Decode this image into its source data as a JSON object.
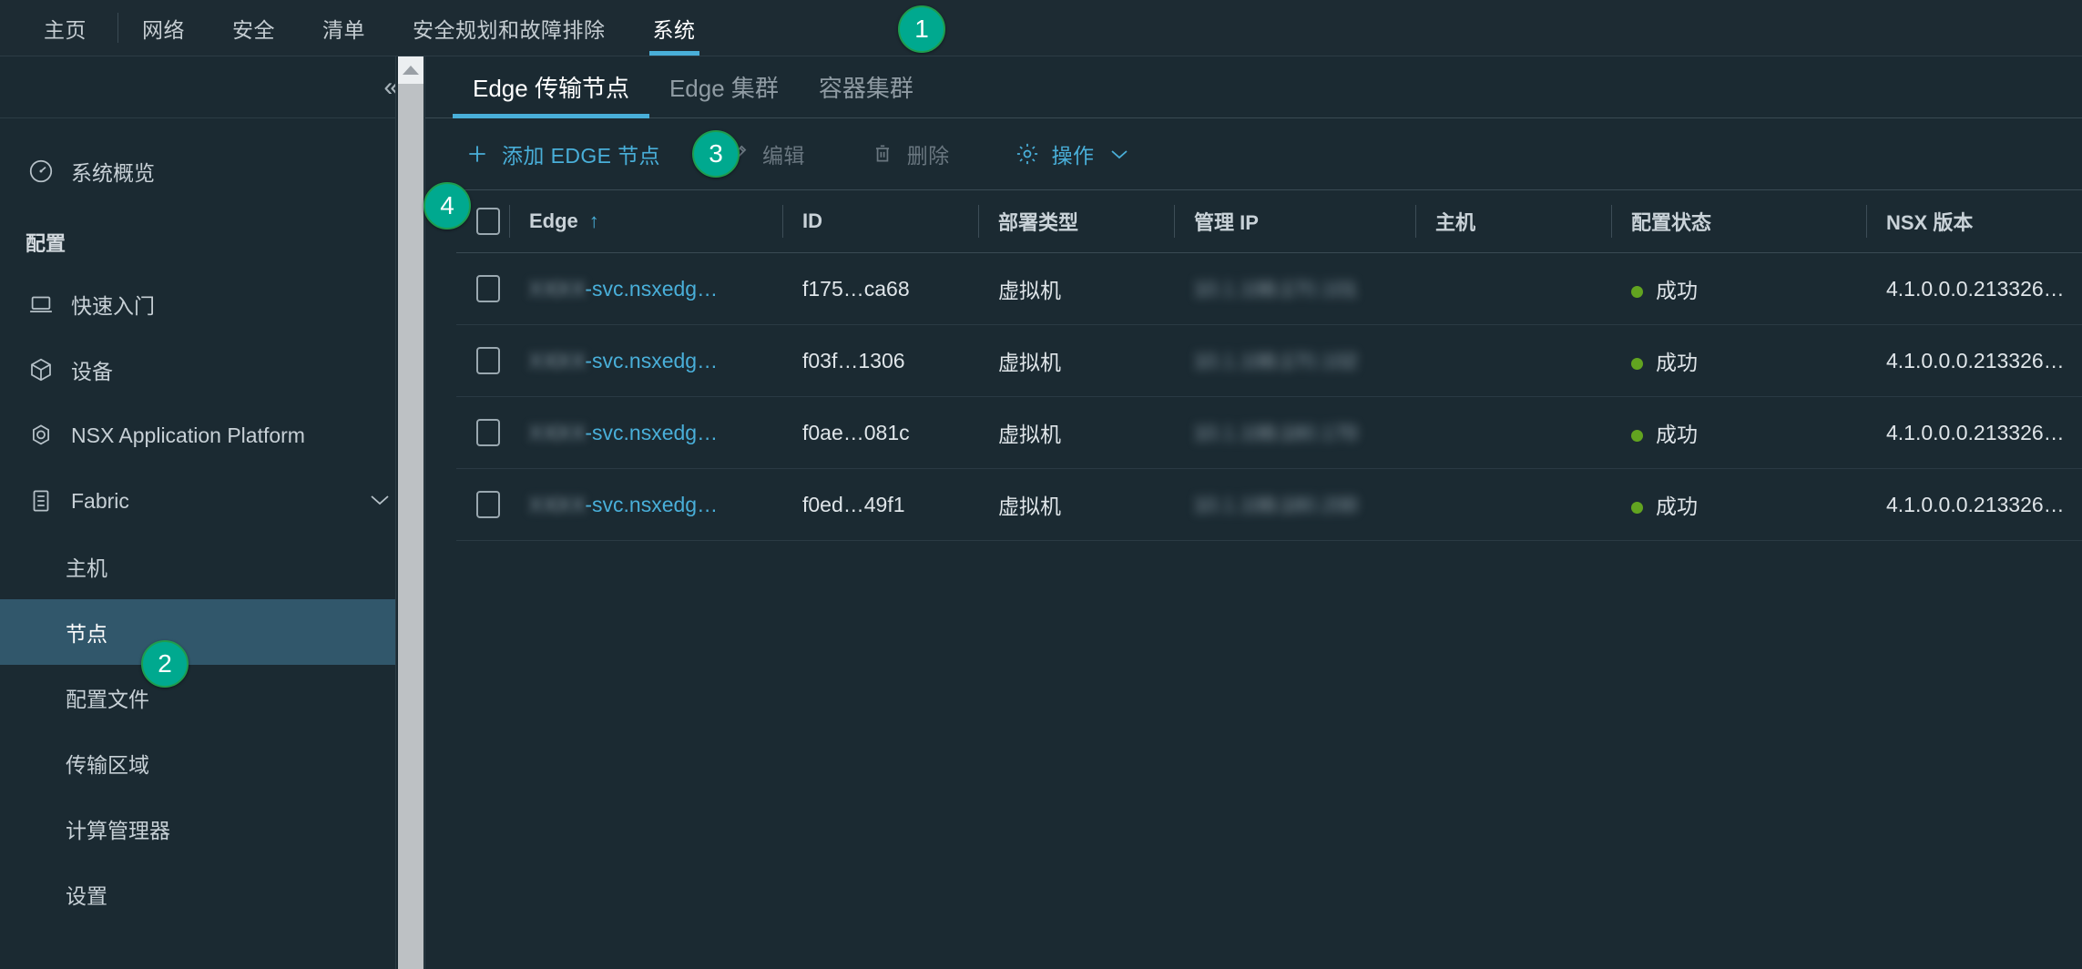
{
  "topnav": {
    "items": [
      {
        "label": "主页",
        "active": false
      },
      {
        "label": "网络",
        "active": false
      },
      {
        "label": "安全",
        "active": false
      },
      {
        "label": "清单",
        "active": false
      },
      {
        "label": "安全规划和故障排除",
        "active": false
      },
      {
        "label": "系统",
        "active": true
      }
    ]
  },
  "sidebar": {
    "collapse_icon": "double-chevron-left-icon",
    "overview": {
      "label": "系统概览",
      "icon": "dashboard-icon"
    },
    "group_title": "配置",
    "items": [
      {
        "label": "快速入门",
        "icon": "laptop-icon"
      },
      {
        "label": "设备",
        "icon": "cube-icon"
      },
      {
        "label": "NSX Application Platform",
        "icon": "nodes-icon"
      },
      {
        "label": "Fabric",
        "icon": "list-icon",
        "expandable": true,
        "caret": "chevron-down-icon"
      }
    ],
    "sub_items": [
      {
        "label": "主机",
        "selected": false
      },
      {
        "label": "节点",
        "selected": true
      },
      {
        "label": "配置文件",
        "selected": false
      },
      {
        "label": "传输区域",
        "selected": false
      },
      {
        "label": "计算管理器",
        "selected": false
      },
      {
        "label": "设置",
        "selected": false
      }
    ]
  },
  "tabs": [
    {
      "label": "Edge 传输节点",
      "active": true
    },
    {
      "label": "Edge 集群",
      "active": false
    },
    {
      "label": "容器集群",
      "active": false
    }
  ],
  "toolbar": {
    "add_label": "添加 EDGE 节点",
    "add_icon": "plus-icon",
    "edit_label": "编辑",
    "edit_icon": "pencil-icon",
    "delete_label": "删除",
    "delete_icon": "trash-icon",
    "actions_label": "操作",
    "actions_icon": "gear-icon",
    "actions_caret": "chevron-down-icon"
  },
  "table": {
    "columns": [
      {
        "key": "checkbox",
        "label": ""
      },
      {
        "key": "edge",
        "label": "Edge",
        "sorted": true,
        "sort_arrow": "↑"
      },
      {
        "key": "id",
        "label": "ID"
      },
      {
        "key": "deploy_type",
        "label": "部署类型"
      },
      {
        "key": "mgmt_ip",
        "label": "管理 IP"
      },
      {
        "key": "host",
        "label": "主机"
      },
      {
        "key": "config_status",
        "label": "配置状态"
      },
      {
        "key": "nsx_version",
        "label": "NSX 版本"
      }
    ],
    "rows": [
      {
        "edge_prefix_redacted": "XXXX",
        "edge": "-svc.nsxedg…",
        "id": "f175…ca68",
        "deploy_type": "虚拟机",
        "mgmt_ip_redacted": "10.1.100.170.101",
        "host": "",
        "config_status": "成功",
        "nsx_version": "4.1.0.0.0.213326…"
      },
      {
        "edge_prefix_redacted": "XXXX",
        "edge": "-svc.nsxedg…",
        "id": "f03f…1306",
        "deploy_type": "虚拟机",
        "mgmt_ip_redacted": "10.1.100.170.102",
        "host": "",
        "config_status": "成功",
        "nsx_version": "4.1.0.0.0.213326…"
      },
      {
        "edge_prefix_redacted": "XXXX",
        "edge": "-svc.nsxedg…",
        "id": "f0ae…081c",
        "deploy_type": "虚拟机",
        "mgmt_ip_redacted": "10.1.100.180.170",
        "host": "",
        "config_status": "成功",
        "nsx_version": "4.1.0.0.0.213326…"
      },
      {
        "edge_prefix_redacted": "XXXX",
        "edge": "-svc.nsxedg…",
        "id": "f0ed…49f1",
        "deploy_type": "虚拟机",
        "mgmt_ip_redacted": "10.1.100.180.200",
        "host": "",
        "config_status": "成功",
        "nsx_version": "4.1.0.0.0.213326…"
      }
    ]
  },
  "annotations": [
    {
      "id": "1",
      "label": "1"
    },
    {
      "id": "2",
      "label": "2"
    },
    {
      "id": "3",
      "label": "3"
    },
    {
      "id": "4",
      "label": "4"
    }
  ],
  "colors": {
    "accent_blue": "#49afd9",
    "badge_green": "#00a98f",
    "status_green": "#62a420",
    "selected_row": "#31576b",
    "background": "#1b2a32"
  }
}
